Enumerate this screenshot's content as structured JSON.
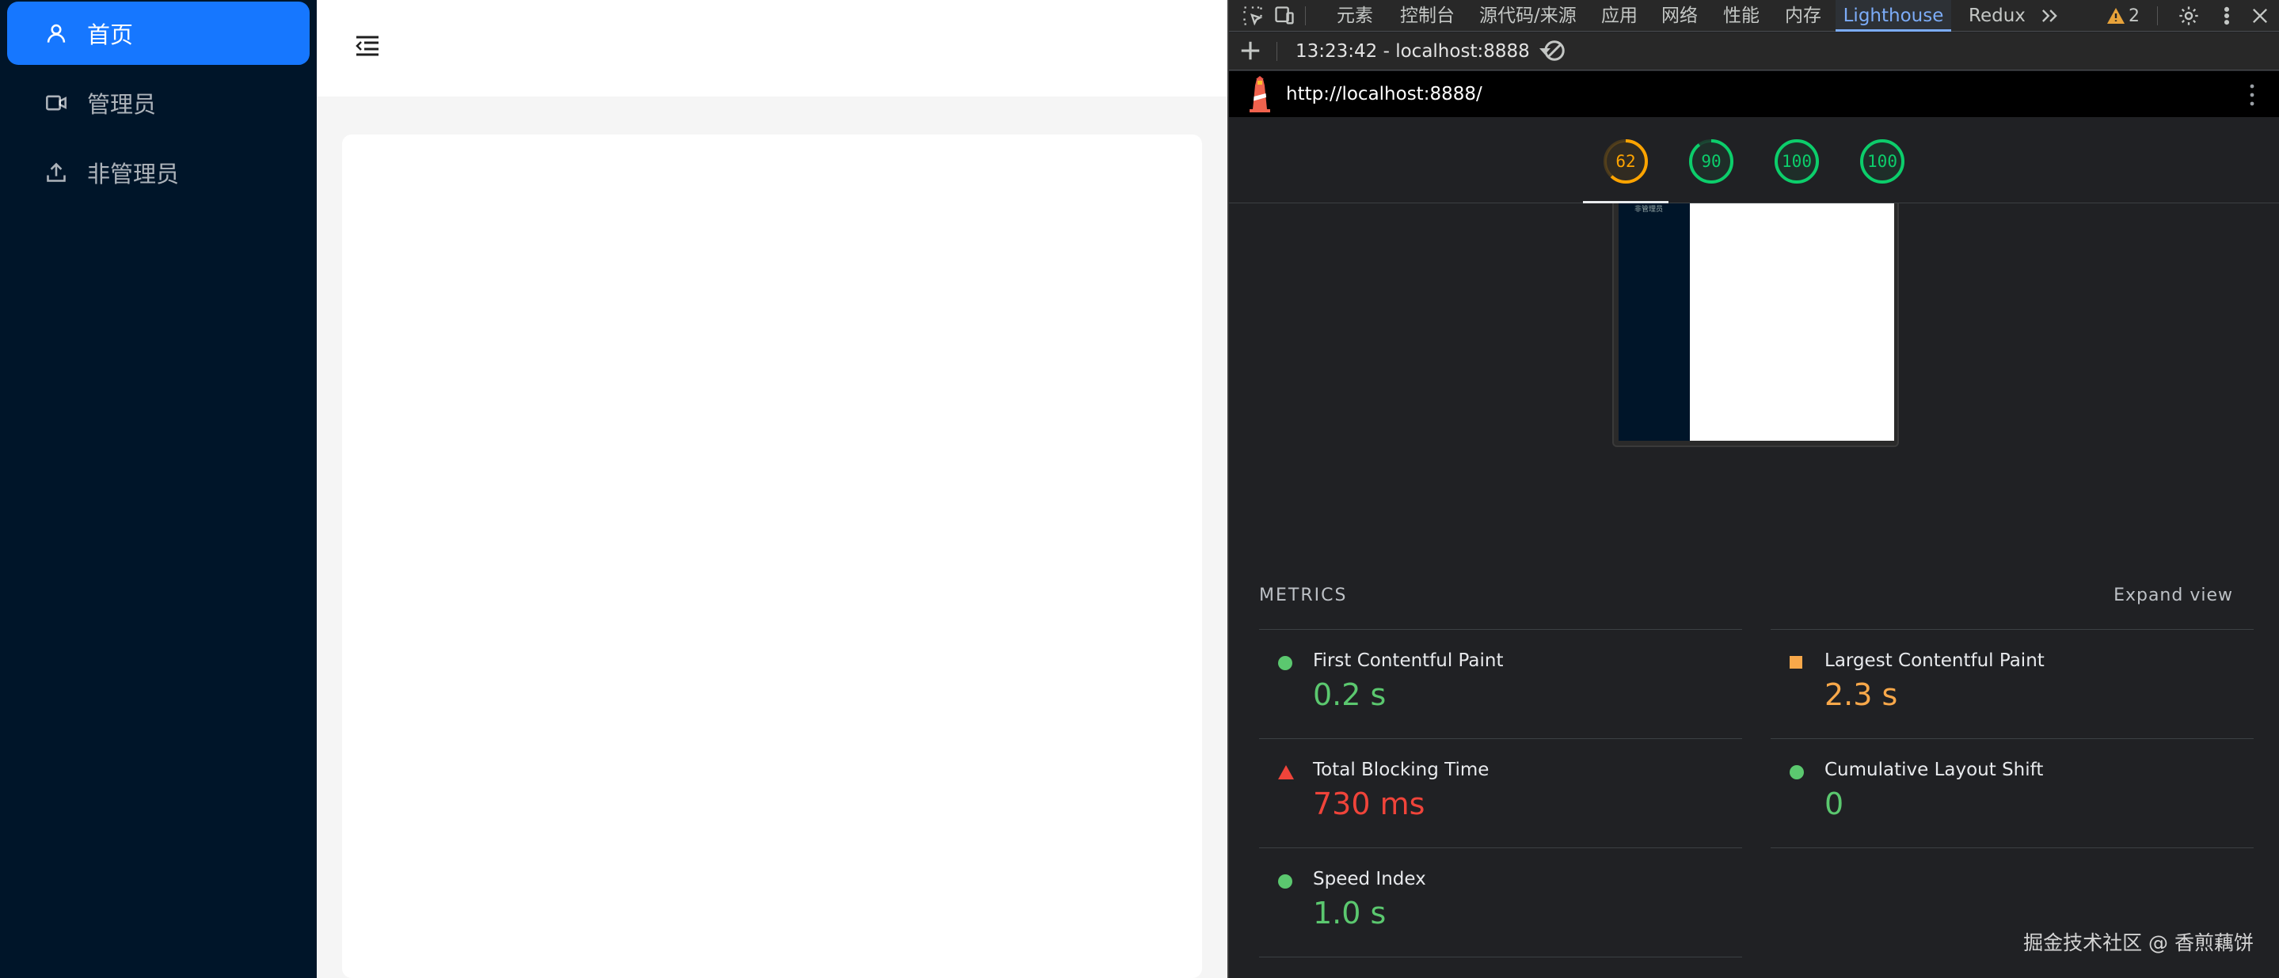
{
  "sidebar": {
    "items": [
      {
        "label": "首页",
        "icon": "user-icon",
        "active": true
      },
      {
        "label": "管理员",
        "icon": "video-camera-icon",
        "active": false
      },
      {
        "label": "非管理员",
        "icon": "upload-icon",
        "active": false
      }
    ]
  },
  "devtools": {
    "tabs": [
      "元素",
      "控制台",
      "源代码/来源",
      "应用",
      "网络",
      "性能",
      "内存",
      "Lighthouse",
      "Redux"
    ],
    "active_tab": "Lighthouse",
    "warning_count": "2",
    "report_selector": "13:23:42 - localhost:8888",
    "url": "http://localhost:8888/",
    "gauges": [
      {
        "score": "62",
        "fraction": 0.62,
        "color": "#ffa400"
      },
      {
        "score": "90",
        "fraction": 0.9,
        "color": "#0cce6b"
      },
      {
        "score": "100",
        "fraction": 1.0,
        "color": "#0cce6b"
      },
      {
        "score": "100",
        "fraction": 1.0,
        "color": "#0cce6b"
      }
    ],
    "thumbnail_label": "非管理员",
    "metrics_heading": "METRICS",
    "expand_label": "Expand view",
    "metrics": [
      {
        "title": "First Contentful Paint",
        "value": "0.2 s",
        "status": "pass"
      },
      {
        "title": "Largest Contentful Paint",
        "value": "2.3 s",
        "status": "average"
      },
      {
        "title": "Total Blocking Time",
        "value": "730 ms",
        "status": "fail"
      },
      {
        "title": "Cumulative Layout Shift",
        "value": "0",
        "status": "pass"
      },
      {
        "title": "Speed Index",
        "value": "1.0 s",
        "status": "pass"
      }
    ]
  },
  "colors": {
    "pass": "#5bc86f",
    "average": "#f8a84a",
    "fail": "#f0443a",
    "sider": "#001529",
    "primary": "#1677ff"
  },
  "watermark": "掘金技术社区 @ 香煎藕饼"
}
